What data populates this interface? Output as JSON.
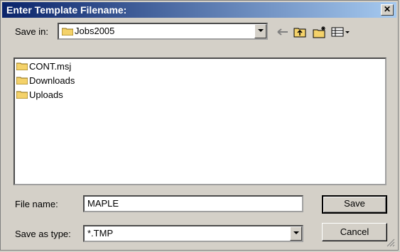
{
  "window": {
    "title": "Enter Template Filename:",
    "close_label": "✕"
  },
  "toolbar": {
    "save_in_label": "Save in:",
    "save_in_value": "Jobs2005",
    "icons": [
      "back-arrow-icon",
      "up-folder-icon",
      "new-folder-icon",
      "view-menu-icon"
    ]
  },
  "files": [
    {
      "name": "CONT.msj"
    },
    {
      "name": "Downloads"
    },
    {
      "name": "Uploads"
    }
  ],
  "form": {
    "file_name_label": "File name:",
    "file_name_value": "MAPLE",
    "save_type_label": "Save as type:",
    "save_type_value": "*.TMP"
  },
  "buttons": {
    "save": "Save",
    "cancel": "Cancel"
  },
  "colors": {
    "title_start": "#0a246a",
    "title_end": "#a6caf0",
    "face": "#d4d0c8",
    "folder": "#f4d26a"
  }
}
